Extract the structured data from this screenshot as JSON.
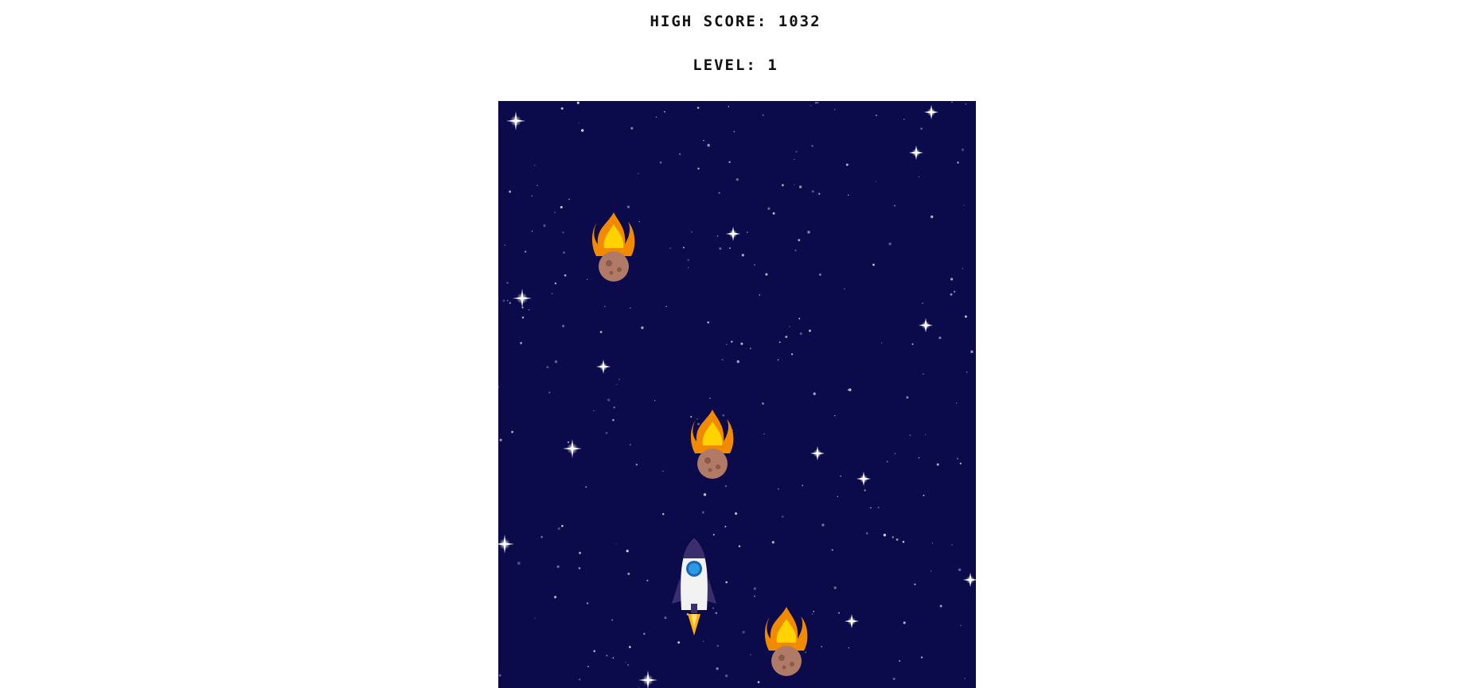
{
  "hud": {
    "high_score_label": "HIGH SCORE:",
    "high_score_value": "1032",
    "level_label": "LEVEL:",
    "level_value": "1"
  },
  "colors": {
    "space_background": "#0b0a4a",
    "page_background": "#ffffff",
    "hud_text": "#111111",
    "flame_outer": "#f28a00",
    "flame_inner": "#ffd200",
    "asteroid": "#b07a66",
    "rocket_body": "#f2f2f2",
    "rocket_window": "#2b9ae6",
    "rocket_fins": "#3a2e6e"
  },
  "game": {
    "player": "rocket-ship",
    "enemies": [
      "flaming-asteroid",
      "flaming-asteroid",
      "flaming-asteroid"
    ]
  }
}
